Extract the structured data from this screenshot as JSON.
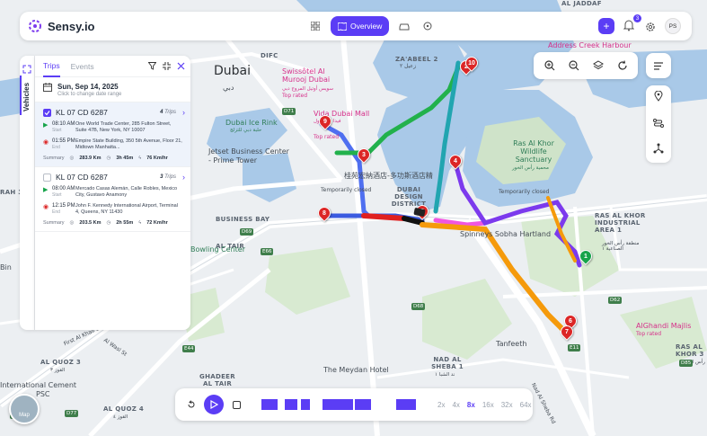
{
  "app": {
    "brand": "Sensy.io"
  },
  "topbar": {
    "nav_overview_label": "Overview",
    "notification_count": "3",
    "user_initials": "PS",
    "accent": "#5b3df5"
  },
  "map": {
    "labels": {
      "dubai": "Dubai",
      "dubai_ar": "دبي",
      "zaabeel2": "ZA'ABEEL 2",
      "zaabeel2_ar": "زعيل ٢",
      "difc": "DIFC",
      "swissotel": "Swissôtel Al Murooj Dubai",
      "swissotel_ar": "سويس أوتيل المروج دبي",
      "swissotel_rated": "Top rated",
      "vida": "Vida Dubai Mall",
      "vida_ar": "فيدا دبي مول",
      "vida_rated": "Top rated",
      "ice_rink": "Dubai Ice Rink",
      "ice_rink_ar": "حلبة دبي للتزلج",
      "jetset": "Jetset Business Center - Prime Tower",
      "hotel_cn": "桂苑宏納酒店-多功斯酒店精",
      "design_district": "DUBAI DESIGN DISTRICT",
      "ras_al_khor": "Ras Al Khor Wildlife Sanctuary",
      "ras_al_khor_ar": "محمية رأس الخور",
      "temp_closed_1": "Temporarily closed",
      "temp_closed_2": "Temporarily closed",
      "spinneys": "Spinneys Sobha Hartland",
      "ras_industrial": "RAS AL KHOR INDUSTRIAL AREA 1",
      "ras_industrial_ar": "منطقة رأس الخور الصناعية ١",
      "business_bay": "BUSINESS BAY",
      "al_tair": "AL TAIR",
      "bowling": "Bowling Center",
      "tanfeeth": "Tanfeeth",
      "meydan": "The Meydan Hotel",
      "ghadeer": "GHADEER AL TAIR",
      "nad_sheba": "NAD AL SHEBA 1",
      "nad_sheba_ar": "ند الشبا ١",
      "alghandi": "AlGhandi Majlis",
      "alghandi_rated": "Top rated",
      "address_creek": "Address Creek Harbour",
      "al_jaddaf": "AL JADDAF",
      "al_quoz3": "AL QUOZ 3",
      "al_quoz3_ar": "القوز ٣",
      "al_quoz4": "AL QUOZ 4",
      "al_quoz4_ar": "القوز ٤",
      "cement": "International Cement",
      "cement_psc": "PSC",
      "ras3": "RAS AL KHOR 3",
      "ras3_ar": "رأس الخور",
      "rah3": "RAH 3",
      "bin": "Bin",
      "nad_al_sheba_rd": "Nad Al Sheba Rd",
      "al_wasl": "Al Wasl St",
      "first_al_khail": "First Al Khail St"
    },
    "road_badges": [
      "D71",
      "D69",
      "E44",
      "E66",
      "D67",
      "D77",
      "D62",
      "D68",
      "D85",
      "E11"
    ],
    "markers": [
      "1",
      "2",
      "3",
      "4",
      "5",
      "6",
      "7",
      "8",
      "9",
      "10"
    ],
    "attribution": "Map"
  },
  "panel": {
    "side_tab_label": "Vehicles",
    "tabs": [
      "Trips",
      "Events"
    ],
    "date_main": "Sun, Sep 14, 2025",
    "date_sub": "Click to change date range",
    "trips": [
      {
        "name": "KL 07 CD 6287",
        "count": "4",
        "count_suffix": "Trips",
        "start_time": "08:10 AM",
        "start_label": "Start",
        "start_addr": "One World Trade Center, 285 Fulton Street, Suite 47B, New York, NY 10007",
        "end_time": "01:55 PM",
        "end_label": "End",
        "end_addr": "Empire State Building, 350 5th Avenue, Floor 21, Midtown Manhatta...",
        "summary_label": "Summary",
        "distance": "283.9 Km",
        "duration": "3h 45m",
        "speed": "76 Km/hr"
      },
      {
        "name": "KL 07 CD 6287",
        "count": "3",
        "count_suffix": "Trips",
        "start_time": "08:00 AM",
        "start_label": "Start",
        "start_addr": "Mercado Casas Alemán, Calle Robles, Mexico City, Gustavo Anamony",
        "end_time": "12:15 PM",
        "end_label": "End",
        "end_addr": "John F. Kennedy International Airport, Terminal 4, Queens, NY 11430",
        "summary_label": "Summary",
        "distance": "203.5 Km",
        "duration": "2h 55m",
        "speed": "72 Km/hr"
      }
    ]
  },
  "playback": {
    "speeds": [
      "2x",
      "4x",
      "8x",
      "16x",
      "32x",
      "64x"
    ],
    "active_speed": "8x"
  }
}
